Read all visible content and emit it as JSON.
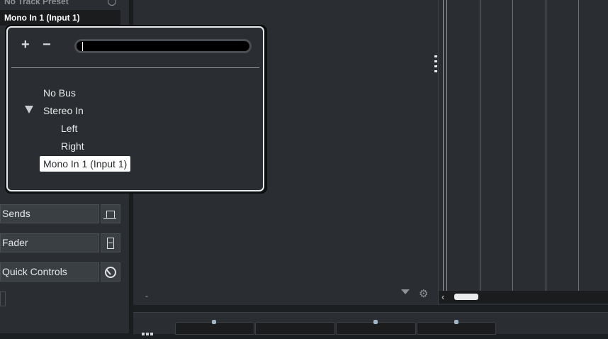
{
  "inspector": {
    "preset_label": "No Track Preset",
    "routing_value": "Mono In 1 (Input 1)",
    "sections": [
      {
        "label": "Sends",
        "icon": "sends-icon"
      },
      {
        "label": "Fader",
        "icon": "fader-icon"
      },
      {
        "label": "Quick Controls",
        "icon": "quick-controls-icon"
      }
    ]
  },
  "main": {
    "dash": "-"
  },
  "popup": {
    "add": "+",
    "remove": "−",
    "search_value": "",
    "items": [
      {
        "label": "No Bus"
      },
      {
        "label": "Stereo In"
      },
      {
        "label": "Left"
      },
      {
        "label": "Right"
      },
      {
        "label": "Mono In 1 (Input 1)",
        "selected": true
      }
    ]
  },
  "scroll": {
    "left_arrow": "‹"
  },
  "colors": {
    "panel_bg": "#2a2e32",
    "dark_bg": "#1a1c1e",
    "selection_bg": "#ffffff",
    "border_light": "#e8eaec"
  }
}
